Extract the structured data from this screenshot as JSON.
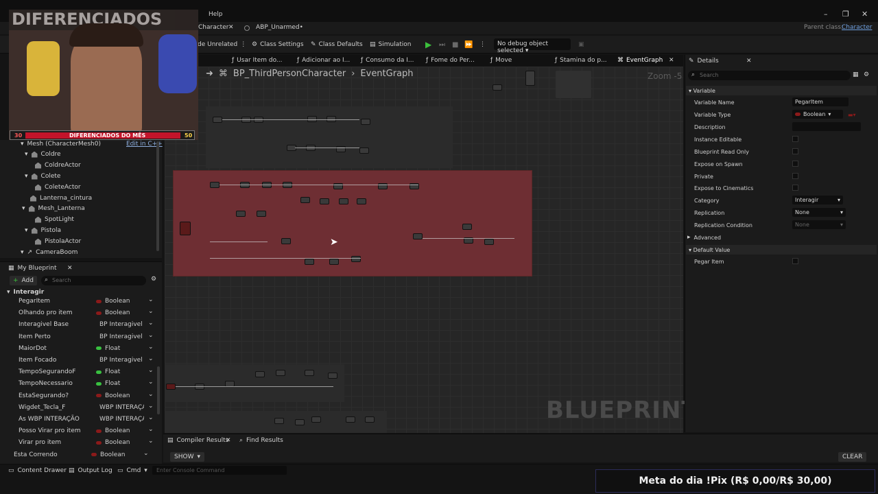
{
  "menu": {
    "help": "Help"
  },
  "doc_tabs": {
    "character": "Character",
    "abp": "ABP_Unarmed•",
    "parent_class_label": "Parent class:",
    "parent_class_value": "Character"
  },
  "toolbar": {
    "unrelated": "de Unrelated",
    "class_settings": "Class Settings",
    "class_defaults": "Class Defaults",
    "simulation": "Simulation",
    "debug_object": "No debug object selected"
  },
  "graph_tabs": [
    "Usar Item do...",
    "Adicionar ao I...",
    "Consumo da I...",
    "Fome do Per...",
    "Move",
    "Stamina do p...",
    "EventGraph"
  ],
  "breadcrumb": {
    "blueprint": "BP_ThirdPersonCharacter",
    "graph": "EventGraph"
  },
  "zoom": "Zoom -5",
  "watermark": "BLUEPRINT",
  "webcam_overlay": {
    "left_count": "30",
    "title": "DIFERENCIADOS DO MÊS",
    "right_count": "50",
    "brand_text": "DIFERENCIADOS"
  },
  "components": {
    "mesh_label": "Mesh (CharacterMesh0)",
    "edit_cpp": "Edit in C++",
    "items": [
      "Coldre",
      "ColdreActor",
      "Colete",
      "ColeteActor",
      "Lanterna_cintura",
      "Mesh_Lanterna",
      "SpotLight",
      "Pistola",
      "PistolaActor",
      "CameraBoom"
    ]
  },
  "my_blueprint": {
    "title": "My Blueprint",
    "add": "Add",
    "search_placeholder": "Search",
    "category": "Interagir",
    "variables": [
      {
        "name": "PegarItem",
        "type": "Boolean",
        "color": "#8b1a1a"
      },
      {
        "name": "Olhando pro item",
        "type": "Boolean",
        "color": "#8b1a1a"
      },
      {
        "name": "Interagivel Base",
        "type": "BP Interagivel E",
        "color": "#2a7fd4"
      },
      {
        "name": "Item Perto",
        "type": "BP Interagivel E",
        "color": "#2a7fd4"
      },
      {
        "name": "MaiorDot",
        "type": "Float",
        "color": "#39c040"
      },
      {
        "name": "Item Focado",
        "type": "BP Interagivel E",
        "color": "#2a7fd4"
      },
      {
        "name": "TempoSegurandoF",
        "type": "Float",
        "color": "#39c040"
      },
      {
        "name": "TempoNecessario",
        "type": "Float",
        "color": "#39c040"
      },
      {
        "name": "EstaSegurando?",
        "type": "Boolean",
        "color": "#8b1a1a"
      },
      {
        "name": "Wigdet_Tecla_F",
        "type": "WBP INTERAÇÃ",
        "color": "#2a7fd4"
      },
      {
        "name": "As WBP INTERAÇÃO",
        "type": "WBP INTERAÇÃ",
        "color": "#2a7fd4"
      },
      {
        "name": "Posso Virar pro item",
        "type": "Boolean",
        "color": "#8b1a1a"
      },
      {
        "name": "Virar pro item",
        "type": "Boolean",
        "color": "#8b1a1a"
      },
      {
        "name": "Esta Correndo",
        "type": "Boolean",
        "color": "#8b1a1a"
      }
    ]
  },
  "details": {
    "title": "Details",
    "search_placeholder": "Search",
    "section_variable": "Variable",
    "variable_name_label": "Variable Name",
    "variable_name_value": "PegarItem",
    "variable_type_label": "Variable Type",
    "variable_type_value": "Boolean",
    "description_label": "Description",
    "instance_editable": "Instance Editable",
    "bp_read_only": "Blueprint Read Only",
    "expose_spawn": "Expose on Spawn",
    "private": "Private",
    "expose_cinematics": "Expose to Cinematics",
    "category_label": "Category",
    "category_value": "Interagir",
    "replication_label": "Replication",
    "replication_value": "None",
    "replication_condition_label": "Replication Condition",
    "replication_condition_value": "None",
    "advanced": "Advanced",
    "section_default": "Default Value",
    "default_pegar_item": "Pegar Item"
  },
  "bottom": {
    "compiler_results": "Compiler Results",
    "find_results": "Find Results",
    "show": "SHOW",
    "clear": "CLEAR"
  },
  "status": {
    "content_drawer": "Content Drawer",
    "output_log": "Output Log",
    "cmd": "Cmd",
    "console_placeholder": "Enter Console Command"
  },
  "meta": "Meta do dia !Pix (R$ 0,00/R$ 30,00)"
}
